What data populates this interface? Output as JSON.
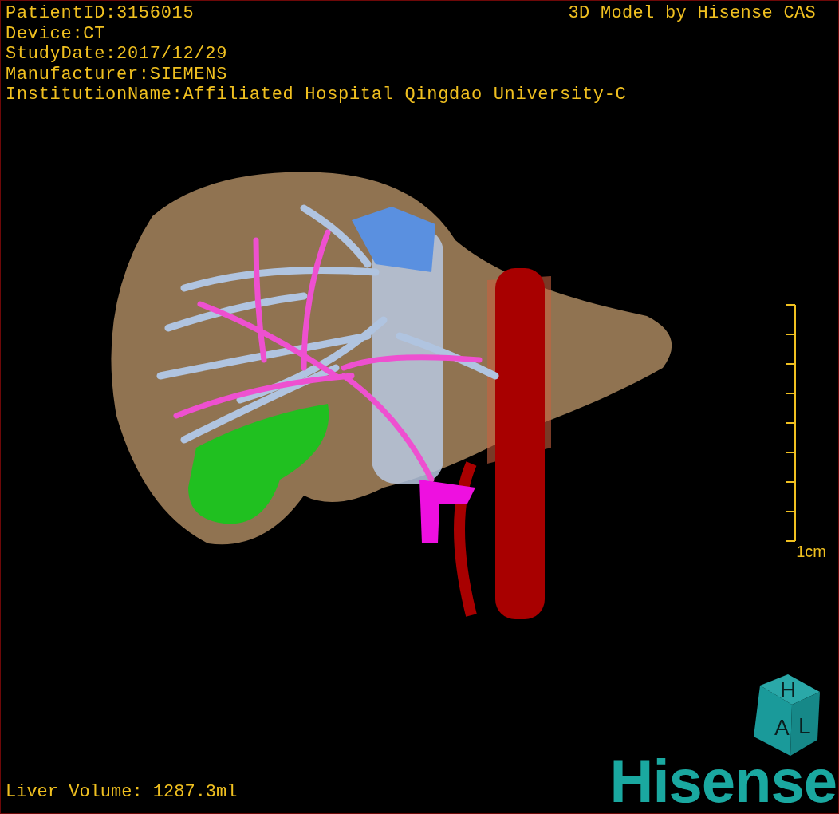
{
  "info_lines": [
    "PatientID:3156015",
    "Device:CT",
    "StudyDate:2017/12/29",
    "Manufacturer:SIEMENS",
    "InstitutionName:Affiliated Hospital Qingdao University-C"
  ],
  "model_credit": "3D Model by Hisense CAS",
  "scale_bar": {
    "label": "1cm"
  },
  "orientation_cube": {
    "faces": [
      "H",
      "A",
      "L"
    ]
  },
  "volume": "Liver Volume: 1287.3ml",
  "logo": "Hisense"
}
